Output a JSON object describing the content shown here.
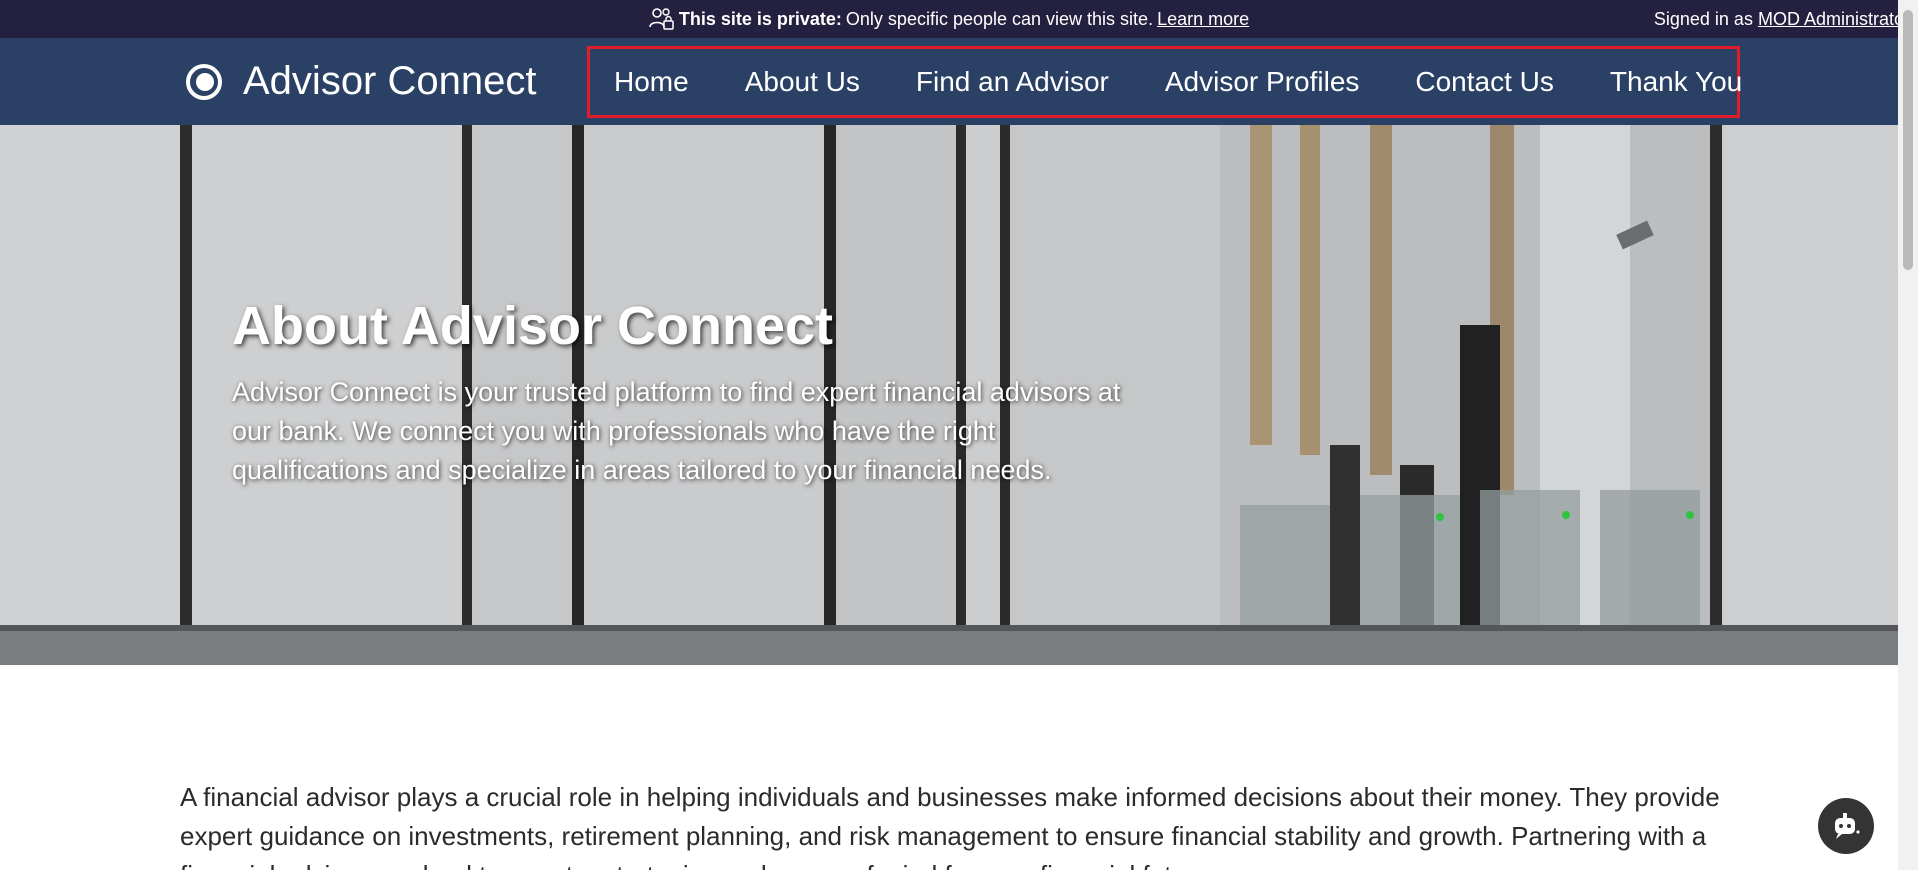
{
  "banner": {
    "strong": "This site is private:",
    "text": "Only specific people can view this site.",
    "learn_more": "Learn more",
    "signed_in_prefix": "Signed in as",
    "user": "MOD Administrator"
  },
  "header": {
    "site_title": "Advisor Connect",
    "nav": [
      "Home",
      "About Us",
      "Find an Advisor",
      "Advisor Profiles",
      "Contact Us",
      "Thank You"
    ],
    "highlight_color": "#e01e2a",
    "bg_color": "#2a4065"
  },
  "hero": {
    "title": "About Advisor Connect",
    "text": "Advisor Connect is your trusted platform to find expert financial advisors at our bank. We connect you with professionals who have the right qualifications and specialize in areas tailored to your financial needs."
  },
  "intro": {
    "text": "A financial advisor plays a crucial role in helping individuals and businesses make informed decisions about their money. They provide expert guidance on investments, retirement planning, and risk management to ensure financial stability and growth. Partnering with a financial advisor can lead to smarter strategies and peace of mind for your financial future."
  },
  "icons": {
    "private": "people-lock-icon",
    "logo": "ring-logo-icon",
    "bot": "copilot-bot-icon"
  }
}
